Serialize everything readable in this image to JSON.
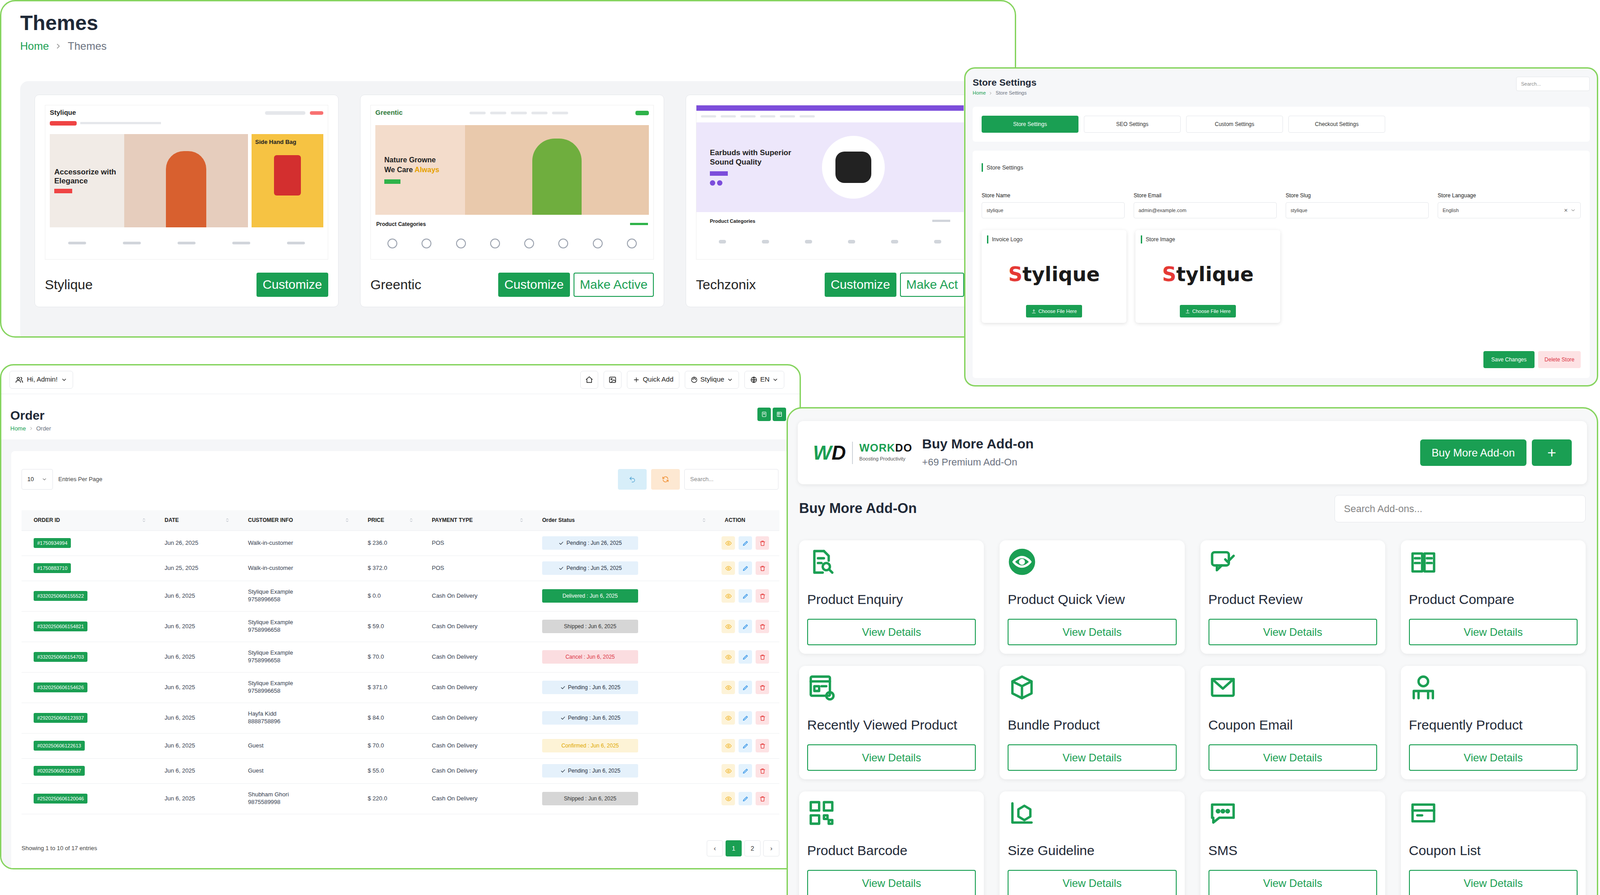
{
  "themes": {
    "title": "Themes",
    "breadcrumb": [
      "Home",
      "Themes"
    ],
    "cards": [
      {
        "name": "Stylique",
        "buttons": [
          "Customize"
        ],
        "preview": {
          "kind": "fashion",
          "logo": "Stylique",
          "headline": "Accessorize with Elegance",
          "side": "Side Hand Bag"
        }
      },
      {
        "name": "Greentic",
        "buttons": [
          "Customize",
          "Make Active"
        ],
        "preview": {
          "kind": "grocery",
          "logo": "Greentic",
          "headline": "Nature Growne",
          "accent_lead": "We Care ",
          "accent": "Always",
          "section": "Product Categories"
        }
      },
      {
        "name": "Techzonix",
        "buttons": [
          "Customize",
          "Make Act"
        ],
        "preview": {
          "kind": "electronics",
          "headline": "Earbuds with Superior Sound Quality",
          "section": "Product Categories"
        }
      }
    ]
  },
  "store": {
    "title": "Store Settings",
    "breadcrumb": [
      "Home",
      "Store Settings"
    ],
    "search": {
      "placeholder": "Search..."
    },
    "tabs": [
      {
        "label": "Store Settings",
        "selected": true
      },
      {
        "label": "SEO Settings",
        "selected": false
      },
      {
        "label": "Custom Settings",
        "selected": false
      },
      {
        "label": "Checkout Settings",
        "selected": false
      }
    ],
    "section": "Store Settings",
    "fields": [
      {
        "label": "Store Name",
        "value": "stylique",
        "kind": "input"
      },
      {
        "label": "Store Email",
        "value": "admin@example.com",
        "kind": "input"
      },
      {
        "label": "Store Slug",
        "value": "stylique",
        "kind": "input"
      },
      {
        "label": "Store Language",
        "value": "English",
        "kind": "select",
        "clear": "×"
      }
    ],
    "images": [
      {
        "label": "Invoice Logo",
        "logo": {
          "initial": "S",
          "rest": "tylique"
        },
        "button": "Choose File Here"
      },
      {
        "label": "Store Image",
        "logo": {
          "initial": "S",
          "rest": "tylique"
        },
        "button": "Choose File Here"
      }
    ],
    "buttons": {
      "save": "Save Changes",
      "delete": "Delete Store"
    }
  },
  "order": {
    "topbar": {
      "user": "Hi, Admin!",
      "quick_add": "Quick Add",
      "store": "Stylique",
      "language": "EN"
    },
    "title": "Order",
    "breadcrumb": [
      "Home",
      "Order"
    ],
    "entries": "10",
    "entries_label": "Entries Per Page",
    "search": {
      "placeholder": "Search..."
    },
    "table": {
      "columns": [
        "ORDER ID",
        "DATE",
        "CUSTOMER INFO",
        "PRICE",
        "PAYMENT TYPE",
        "Order Status",
        "ACTION"
      ],
      "rows": [
        {
          "id": "#1750934994",
          "date": "Jun 26, 2025",
          "customer": [
            "Walk-in-customer"
          ],
          "price": "$ 236.0",
          "payment": "POS",
          "status": "Pending : Jun 26, 2025",
          "kind": "pending",
          "color": "#e5f1fb"
        },
        {
          "id": "#1750883710",
          "date": "Jun 25, 2025",
          "customer": [
            "Walk-in-customer"
          ],
          "price": "$ 372.0",
          "payment": "POS",
          "status": "Pending : Jun 25, 2025",
          "kind": "pending",
          "color": "#e5f1fb"
        },
        {
          "id": "#3320250606155522",
          "date": "Jun 6, 2025",
          "customer": [
            "Stylique Example",
            "9758996658"
          ],
          "price": "$ 0.0",
          "payment": "Cash On Delivery",
          "status": "Delivered : Jun 6, 2025",
          "kind": "delivered",
          "color": "#1a9f53"
        },
        {
          "id": "#3320250606154821",
          "date": "Jun 6, 2025",
          "customer": [
            "Stylique Example",
            "9758996658"
          ],
          "price": "$ 59.0",
          "payment": "Cash On Delivery",
          "status": "Shipped : Jun 6, 2025",
          "kind": "shipped",
          "color": "#d6d6d6"
        },
        {
          "id": "#3320250606154703",
          "date": "Jun 6, 2025",
          "customer": [
            "Stylique Example",
            "9758996658"
          ],
          "price": "$ 70.0",
          "payment": "Cash On Delivery",
          "status": "Cancel : Jun 6, 2025",
          "kind": "cancel",
          "color": "#fbdde0"
        },
        {
          "id": "#3320250606154626",
          "date": "Jun 6, 2025",
          "customer": [
            "Stylique Example",
            "9758996658"
          ],
          "price": "$ 371.0",
          "payment": "Cash On Delivery",
          "status": "Pending : Jun 6, 2025",
          "kind": "pending",
          "color": "#e5f1fb"
        },
        {
          "id": "#2920250606123937",
          "date": "Jun 6, 2025",
          "customer": [
            "Hayfa Kidd",
            "8888758896"
          ],
          "price": "$ 84.0",
          "payment": "Cash On Delivery",
          "status": "Pending : Jun 6, 2025",
          "kind": "pending",
          "color": "#e5f1fb"
        },
        {
          "id": "#020250606122613",
          "date": "Jun 6, 2025",
          "customer": [
            "Guest"
          ],
          "price": "$ 70.0",
          "payment": "Cash On Delivery",
          "status": "Confirmed : Jun 6, 2025",
          "kind": "confirmed",
          "color": "#fdf3d6"
        },
        {
          "id": "#020250606122637",
          "date": "Jun 6, 2025",
          "customer": [
            "Guest"
          ],
          "price": "$ 55.0",
          "payment": "Cash On Delivery",
          "status": "Pending : Jun 6, 2025",
          "kind": "pending",
          "color": "#e5f1fb"
        },
        {
          "id": "#2520250606120046",
          "date": "Jun 6, 2025",
          "customer": [
            "Shubham Ghori",
            "9875589998"
          ],
          "price": "$ 220.0",
          "payment": "Cash On Delivery",
          "status": "Shipped : Jun 6, 2025",
          "kind": "shipped",
          "color": "#d6d6d6"
        }
      ]
    },
    "footer": "Showing 1 to 10 of 17 entries",
    "pagination": [
      {
        "label": "‹",
        "selected": false
      },
      {
        "label": "1",
        "selected": true
      },
      {
        "label": "2",
        "selected": false
      },
      {
        "label": "›",
        "selected": false
      }
    ]
  },
  "addons": {
    "brand": {
      "mark": [
        "W",
        "D"
      ],
      "name": [
        "WORK",
        "DO"
      ],
      "tagline": "Boosting Productivity"
    },
    "title": "Buy More Add-on",
    "subtitle": "+69 Premium Add-On",
    "buy_button": "Buy More Add-on",
    "add_button": "+",
    "section": "Buy More Add-On",
    "search": {
      "placeholder": "Search Add-ons..."
    },
    "items": [
      {
        "name": "Product Enquiry",
        "button": "View Details"
      },
      {
        "name": "Product Quick View",
        "button": "View Details"
      },
      {
        "name": "Product Review",
        "button": "View Details"
      },
      {
        "name": "Product Compare",
        "button": "View Details"
      },
      {
        "name": "Recently Viewed Product",
        "button": "View Details"
      },
      {
        "name": "Bundle Product",
        "button": "View Details"
      },
      {
        "name": "Coupon Email",
        "button": "View Details"
      },
      {
        "name": "Frequently Product",
        "button": "View Details"
      },
      {
        "name": "Product Barcode",
        "button": "View Details"
      },
      {
        "name": "Size Guideline",
        "button": "View Details"
      },
      {
        "name": "SMS",
        "button": "View Details"
      },
      {
        "name": "Coupon List",
        "button": "View Details"
      }
    ]
  }
}
